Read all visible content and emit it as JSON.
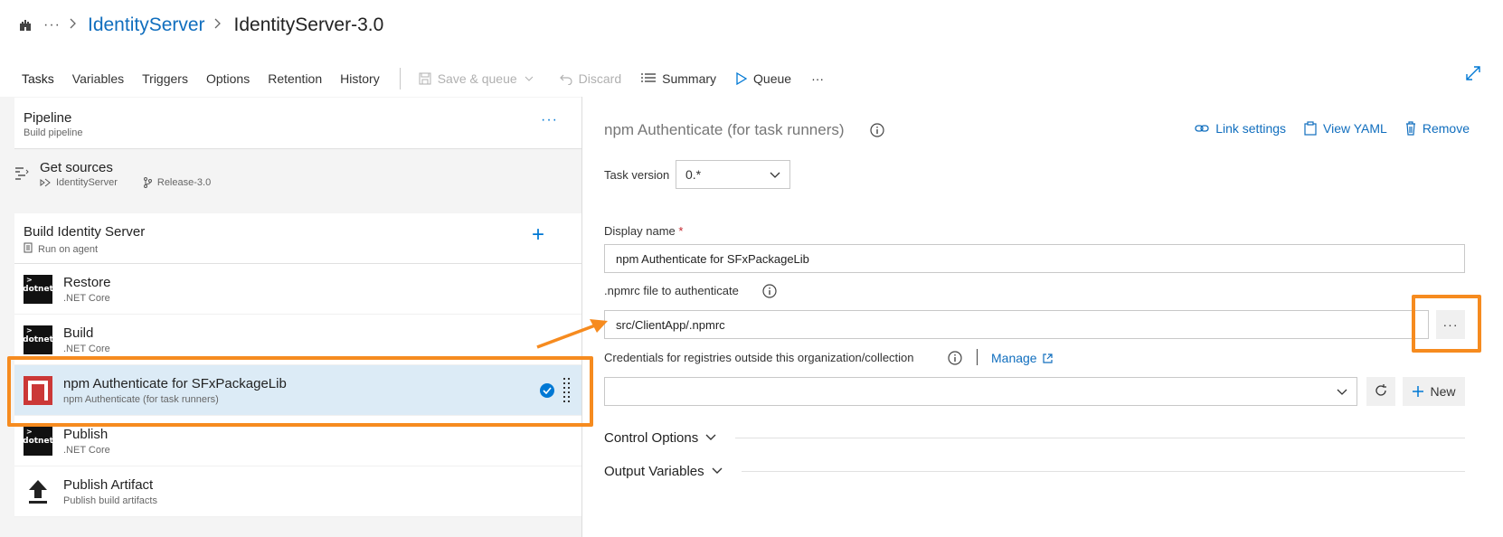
{
  "header": {
    "breadcrumb_dots": "···",
    "project": "IdentityServer",
    "pipeline": "IdentityServer-3.0"
  },
  "toolbar": {
    "tabs": [
      "Tasks",
      "Variables",
      "Triggers",
      "Options",
      "Retention",
      "History"
    ],
    "active_tab": "Tasks",
    "save_queue": "Save & queue",
    "discard": "Discard",
    "summary": "Summary",
    "queue": "Queue",
    "more": "···"
  },
  "left": {
    "pipeline": {
      "title": "Pipeline",
      "subtitle": "Build pipeline",
      "more": "···"
    },
    "get_sources": {
      "title": "Get sources",
      "repo": "IdentityServer",
      "branch": "Release-3.0"
    },
    "phase": {
      "title": "Build Identity Server",
      "subtitle": "Run on agent",
      "add": "+"
    },
    "tasks": [
      {
        "name": "Restore",
        "sub": ".NET Core",
        "icon": "dotnet-icon",
        "icon_text": "dotnet"
      },
      {
        "name": "Build",
        "sub": ".NET Core",
        "icon": "dotnet-icon",
        "icon_text": "dotnet"
      },
      {
        "name": "npm Authenticate for SFxPackageLib",
        "sub": "npm Authenticate (for task runners)",
        "icon": "npm-icon",
        "icon_text": ""
      },
      {
        "name": "Publish",
        "sub": ".NET Core",
        "icon": "dotnet-icon",
        "icon_text": "dotnet"
      },
      {
        "name": "Publish Artifact",
        "sub": "Publish build artifacts",
        "icon": "upload-arrow-icon",
        "icon_text": ""
      }
    ]
  },
  "right": {
    "title": "npm Authenticate (for task runners)",
    "actions": {
      "link_settings": "Link settings",
      "view_yaml": "View YAML",
      "remove": "Remove"
    },
    "task_version_label": "Task version",
    "task_version_value": "0.*",
    "display_name_label": "Display name",
    "required_mark": "*",
    "display_name_value": "npm Authenticate for SFxPackageLib",
    "npmrc_label": ".npmrc file to authenticate",
    "npmrc_value": "src/ClientApp/.npmrc",
    "browse": "···",
    "credentials_label": "Credentials for registries outside this organization/collection",
    "manage": "Manage",
    "new_button": "New",
    "control_options": "Control Options",
    "output_variables": "Output Variables"
  },
  "colors": {
    "accent": "#0078d4",
    "link": "#106ebe",
    "highlight": "#f68b1f",
    "selected_row": "#dcebf6",
    "npm": "#cb3837"
  }
}
